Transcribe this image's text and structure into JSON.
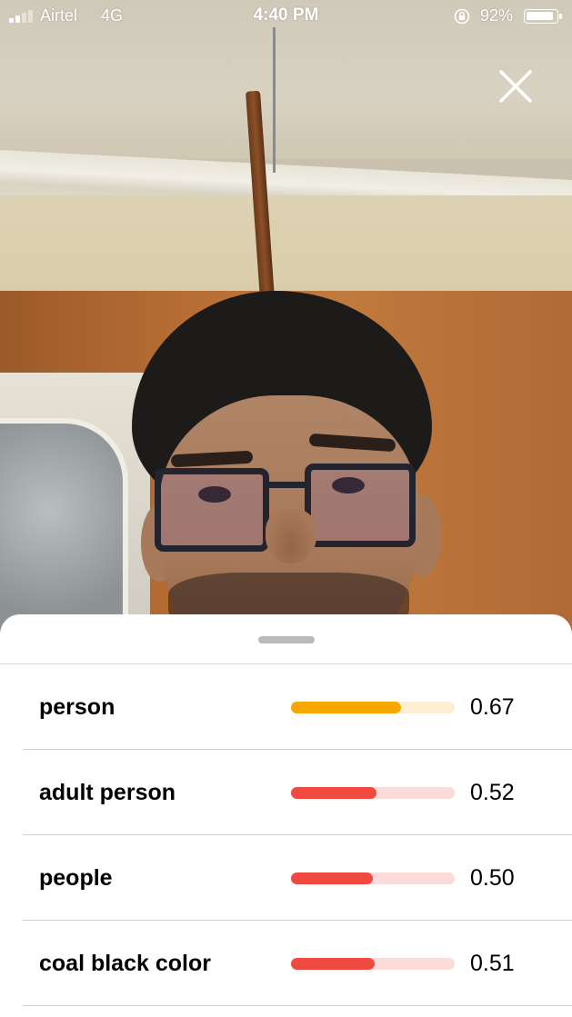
{
  "status_bar": {
    "carrier": "Airtel",
    "network": "4G",
    "time": "4:40 PM",
    "battery_percent": "92%",
    "battery_level": 0.92,
    "signal_bars_filled": 2,
    "signal_bars_total": 4
  },
  "close_button": {
    "icon": "close-icon"
  },
  "results": [
    {
      "label": "person",
      "value": "0.67",
      "score": 0.67,
      "level": "high"
    },
    {
      "label": "adult person",
      "value": "0.52",
      "score": 0.52,
      "level": "low"
    },
    {
      "label": "people",
      "value": "0.50",
      "score": 0.5,
      "level": "low"
    },
    {
      "label": "coal black color",
      "value": "0.51",
      "score": 0.51,
      "level": "low"
    }
  ],
  "colors": {
    "high_fill": "#f7a800",
    "high_track": "#fdf0d2",
    "low_fill": "#f04a40",
    "low_track": "#fcdcda",
    "sheet_background": "#ffffff",
    "grabber": "#b9b9b9"
  }
}
